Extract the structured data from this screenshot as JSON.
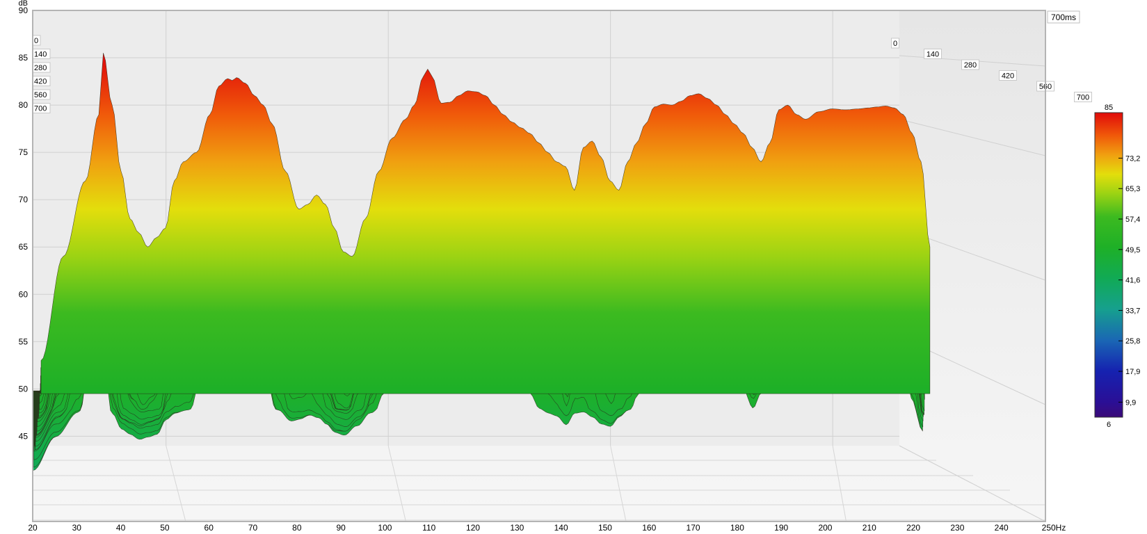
{
  "chart_data": {
    "type": "waterfall",
    "y_axis": {
      "unit": "dB",
      "ticks": [
        "90",
        "85",
        "80",
        "75",
        "70",
        "65",
        "60",
        "55",
        "50",
        "45"
      ],
      "range": [
        44,
        90
      ]
    },
    "x_axis": {
      "unit": "Hz",
      "ticks": [
        "20",
        "30",
        "40",
        "50",
        "60",
        "70",
        "80",
        "90",
        "100",
        "110",
        "120",
        "130",
        "140",
        "150",
        "160",
        "170",
        "180",
        "190",
        "200",
        "210",
        "220",
        "230",
        "240",
        "250Hz"
      ],
      "range": [
        20,
        250
      ]
    },
    "time_axis": {
      "ticks": [
        "0",
        "140",
        "280",
        "420",
        "560",
        "700"
      ],
      "range_label": "700ms",
      "range": [
        0,
        700
      ]
    },
    "colorbar": {
      "max_label": "85",
      "labels": [
        "73,2",
        "65,3",
        "57,4",
        "49,5",
        "41,6",
        "33,7",
        "25,8",
        "17,9",
        "9,9"
      ],
      "min_label": "6",
      "range": [
        6,
        85
      ]
    },
    "front_slice": {
      "time_ms": 0,
      "freq_hz": [
        20,
        25,
        30,
        33,
        34,
        36,
        38,
        40,
        42,
        44,
        46,
        48,
        50,
        52,
        55,
        58,
        60,
        62,
        63,
        64,
        66,
        68,
        70,
        72,
        75,
        78,
        80,
        82,
        84,
        86,
        88,
        90,
        93,
        96,
        99,
        102,
        104,
        106,
        107,
        108,
        110,
        112,
        114,
        116,
        118,
        120,
        122,
        124,
        126,
        128,
        130,
        132,
        134,
        136,
        138,
        140,
        142,
        144,
        146,
        148,
        150,
        152,
        154,
        156,
        158,
        160,
        162,
        164,
        166,
        168,
        170,
        172,
        174,
        176,
        178,
        180,
        182,
        184,
        186,
        188,
        190,
        192,
        195,
        198,
        201,
        204,
        206,
        208,
        210,
        212,
        214,
        216,
        218,
        220
      ],
      "db": [
        53,
        64,
        72,
        79,
        85.5,
        80,
        73,
        68,
        66.5,
        65,
        66,
        67,
        72,
        74,
        75,
        79,
        82,
        82.8,
        82.6,
        82.9,
        82.3,
        81,
        80,
        78,
        73,
        69,
        69.5,
        70.5,
        69.5,
        67,
        64.5,
        64,
        68,
        73,
        76.5,
        78.5,
        80,
        83,
        83.8,
        83,
        80.2,
        80.3,
        81,
        81.5,
        81.4,
        81,
        80,
        79,
        78.2,
        77.6,
        77,
        76,
        75,
        74,
        73.5,
        71,
        75.5,
        76.2,
        74.5,
        72,
        71,
        74,
        76,
        78,
        79.8,
        80.1,
        80,
        80.4,
        81,
        81.2,
        80.7,
        80,
        79,
        78,
        77,
        75.5,
        74,
        76,
        79.5,
        80,
        79,
        78.5,
        79.3,
        79.6,
        79.5,
        79.6,
        79.7,
        79.8,
        79.9,
        79.7,
        79,
        77,
        74,
        65
      ]
    },
    "colors": {
      "stops": [
        {
          "db": 85,
          "color": "#e00a0a"
        },
        {
          "db": 79,
          "color": "#f05a0a"
        },
        {
          "db": 74,
          "color": "#f0a010"
        },
        {
          "db": 69,
          "color": "#e3de0c"
        },
        {
          "db": 64,
          "color": "#9cd313"
        },
        {
          "db": 58,
          "color": "#3cba20"
        },
        {
          "db": 50,
          "color": "#1eb027"
        },
        {
          "db": 42,
          "color": "#11aa55"
        },
        {
          "db": 34,
          "color": "#16a08e"
        },
        {
          "db": 26,
          "color": "#1a67b4"
        },
        {
          "db": 18,
          "color": "#1522b0"
        },
        {
          "db": 10,
          "color": "#2a0f96"
        },
        {
          "db": 6,
          "color": "#3b0a78"
        }
      ]
    }
  }
}
